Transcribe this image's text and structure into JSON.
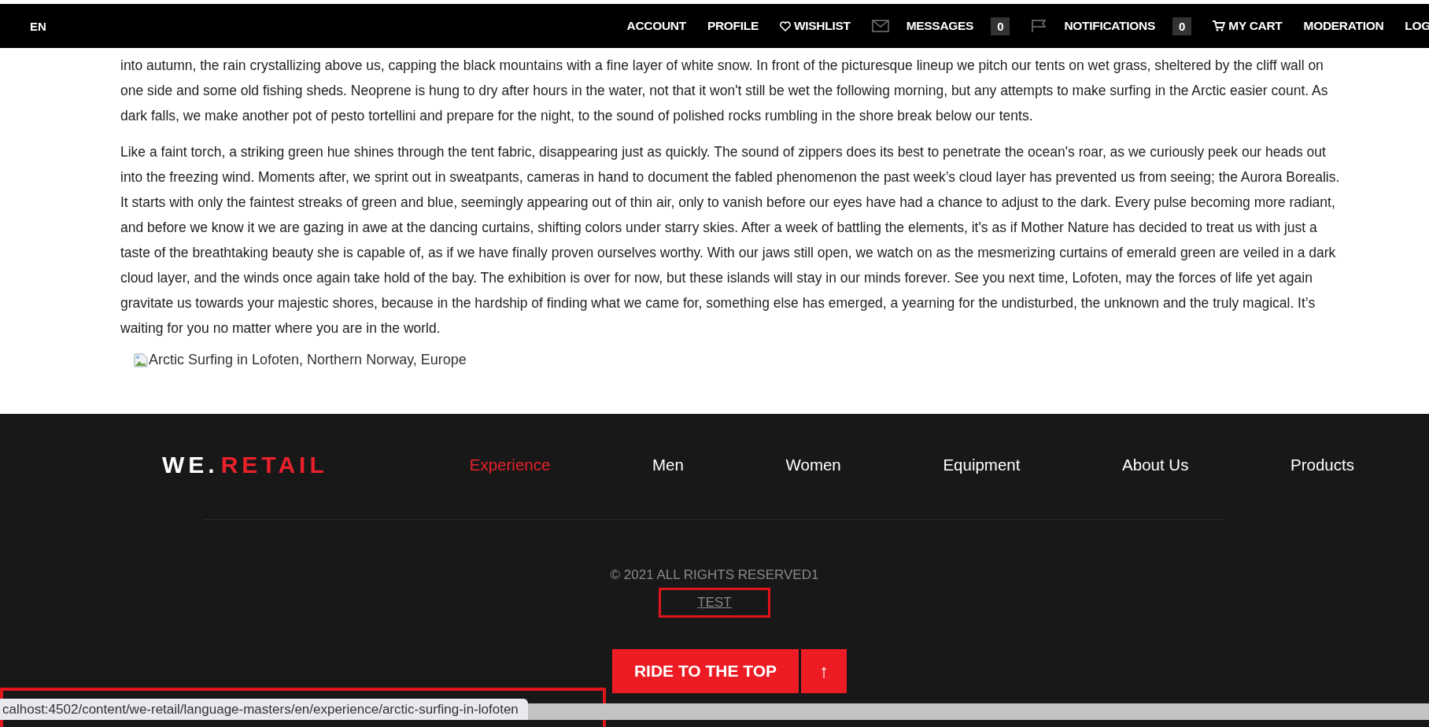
{
  "top_nav": {
    "language": "EN",
    "items": [
      {
        "kind": "plain",
        "label": "ACCOUNT"
      },
      {
        "kind": "plain",
        "label": "PROFILE"
      },
      {
        "kind": "heart",
        "label": "WISHLIST"
      },
      {
        "kind": "mail",
        "label": "MESSAGES",
        "count": "0"
      },
      {
        "kind": "flag",
        "label": "NOTIFICATIONS",
        "count": "0"
      },
      {
        "kind": "cart",
        "label": "MY CART"
      },
      {
        "kind": "plain",
        "label": "MODERATION"
      },
      {
        "kind": "plain",
        "label": "LOG"
      }
    ]
  },
  "article": {
    "paragraphs": [
      "into autumn, the rain crystallizing above us, capping the black mountains with a fine layer of white snow. In front of the picturesque lineup we pitch our tents on wet grass, sheltered by the cliff wall on one side and some old fishing sheds. Neoprene is hung to dry after hours in the water, not that it won't still be wet the following morning, but any attempts to make surfing in the Arctic easier count. As dark falls, we make another pot of pesto tortellini and prepare for the night, to the sound of polished rocks rumbling in the shore break below our tents.",
      "Like a faint torch, a striking green hue shines through the tent fabric, disappearing just as quickly. The sound of zippers does its best to penetrate the ocean's roar, as we curiously peek our heads out into the freezing wind. Moments after, we sprint out in sweatpants, cameras in hand to document the fabled phenomenon the past week’s cloud layer has prevented us from seeing; the Aurora Borealis. It starts with only the faintest streaks of green and blue, seemingly appearing out of thin air, only to vanish before our eyes have had a chance to adjust to the dark. Every pulse becoming more radiant, and before we know it we are gazing in awe at the dancing curtains, shifting colors under starry skies. After a week of battling the elements, it's as if Mother Nature has decided to treat us with just a taste of the breathtaking beauty she is capable of, as if we have finally proven ourselves worthy. With our jaws still open, we watch on as the mesmerizing curtains of emerald green are veiled in a dark cloud layer, and the winds once again take hold of the bay. The exhibition is over for now, but these islands will stay in our minds forever. See you next time, Lofoten, may the forces of life yet again gravitate us towards your majestic shores, because in the hardship of finding what we came for, something else has emerged, a yearning for the undisturbed, the unknown and the truly magical. It’s waiting for you no matter where you are in the world."
    ],
    "broken_image_alt": "Arctic Surfing in Lofoten, Northern Norway, Europe"
  },
  "footer": {
    "logo": {
      "part_1": "WE.",
      "part_2": "RETAIL"
    },
    "nav": [
      {
        "label": "Experience",
        "selected": true
      },
      {
        "label": "Men",
        "selected": false
      },
      {
        "label": "Women",
        "selected": false
      },
      {
        "label": "Equipment",
        "selected": false
      },
      {
        "label": "About Us",
        "selected": false
      },
      {
        "label": "Products",
        "selected": false
      }
    ],
    "copyright": "© 2021 ALL RIGHTS RESERVED1",
    "link": "TEST",
    "top_button": "RIDE TO THE TOP",
    "top_arrow": "↑"
  },
  "status_url": "calhost:4502/content/we-retail/language-masters/en/experience/arctic-surfing-in-lofoten"
}
